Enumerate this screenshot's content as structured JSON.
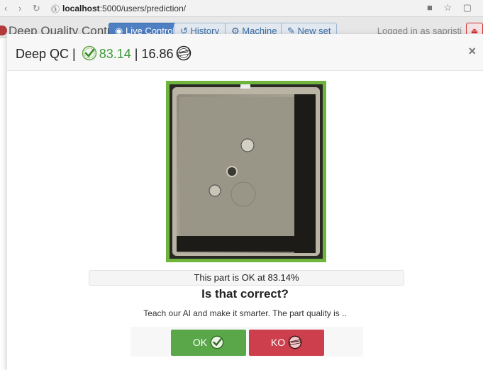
{
  "browser": {
    "url_host": "localhost",
    "url_rest": ":5000/users/prediction/"
  },
  "appnav": {
    "brand": "Deep Quality Control",
    "tabs": [
      "Live Control",
      "History",
      "Machine",
      "New set"
    ],
    "logged_in": "Logged in as sapristi"
  },
  "modal": {
    "title_prefix": "Deep QC |",
    "ok_score": "83.14",
    "separator": "|",
    "defect_score": "16.86",
    "close_symbol": "×",
    "result_text": "This part is OK at 83.14%",
    "question": "Is that correct?",
    "teach_text": "Teach our AI and make it smarter. The part quality is ..",
    "ok_button": "OK",
    "ko_button": "KO"
  },
  "colors": {
    "ok_green": "#5aa74a",
    "ko_red": "#cd3f4c",
    "frame_green": "#6fb53d"
  },
  "icons": {
    "ok_badge": "check-seal-icon",
    "defect_badge": "defect-stamp-icon"
  }
}
